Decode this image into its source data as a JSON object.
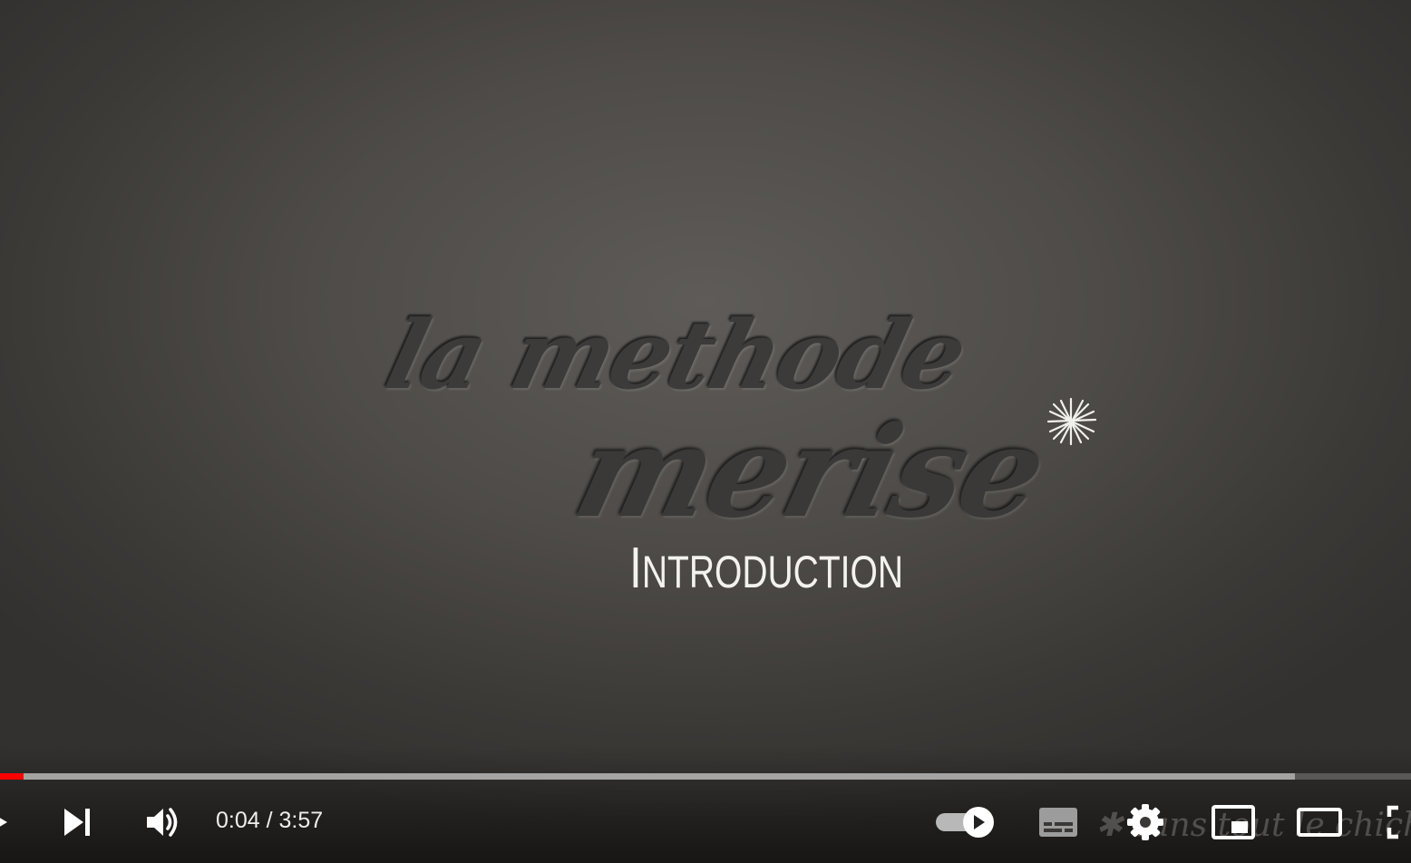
{
  "video": {
    "title_line1": "la methode",
    "title_line2": "merise",
    "subtitle_first_letter": "I",
    "subtitle_rest": "NTRODUCTION",
    "watermark": "sans tout le chichi"
  },
  "player": {
    "current_time": "0:04",
    "separator": " / ",
    "duration": "3:57",
    "progress_played_fraction": 0.017,
    "progress_loaded_fraction": 0.918,
    "autoplay_on": true
  },
  "icons": {
    "play": "play-icon",
    "next": "next-icon",
    "volume": "volume-icon",
    "autoplay": "autoplay-toggle-icon",
    "subtitles": "subtitles-icon",
    "settings": "gear-icon",
    "miniplayer": "miniplayer-icon",
    "theater": "theater-mode-icon",
    "fullscreen": "fullscreen-icon"
  },
  "colors": {
    "accent": "#ff0000",
    "control_icon": "#ffffff",
    "subtitle_text": "#f4f2ef"
  }
}
